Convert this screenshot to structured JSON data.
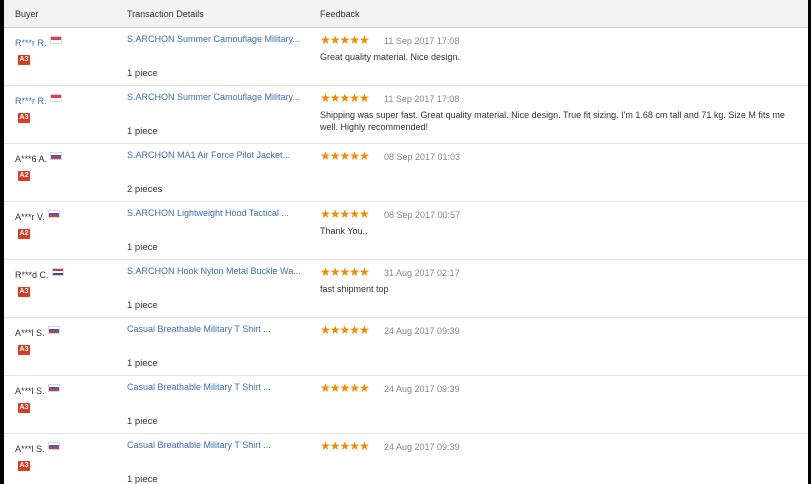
{
  "header": {
    "buyer": "Buyer",
    "transaction": "Transaction Details",
    "feedback": "Feedback"
  },
  "colors": {
    "star": "#f08c00",
    "link": "#3a6fb5",
    "badge": "#d83c22"
  },
  "rows": [
    {
      "buyer": "R***r R.",
      "buyer_link": true,
      "flag": "sg",
      "level": "A3",
      "product": "S.ARCHON Summer Camouflage Military...",
      "quantity": "1 piece",
      "stars": "★★★★★",
      "date": "11 Sep 2017 17:08",
      "feedback": "Great quality material. Nice design."
    },
    {
      "buyer": "R***r R.",
      "buyer_link": true,
      "flag": "sg",
      "level": "A3",
      "product": "S.ARCHON Summer Camouflage Military...",
      "quantity": "1 piece",
      "stars": "★★★★★",
      "date": "11 Sep 2017 17:08",
      "feedback": "Shipping was super fast. Great quality material. Nice design. True fit sizing. I'm 1.68 cm tall and 71 kg. Size M fits me well. Highly recommended!"
    },
    {
      "buyer": "A***6 A.",
      "buyer_link": false,
      "flag": "ru",
      "level": "A2",
      "product": "S.ARCHON MA1 Air Force Pilot Jacket...",
      "quantity": "2 pieces",
      "stars": "★★★★★",
      "date": "08 Sep 2017 01:03",
      "feedback": ""
    },
    {
      "buyer": "A***r V.",
      "buyer_link": false,
      "flag": "ru",
      "level": "A2",
      "product": "S.ARCHON Lightweight Hood Tactical ...",
      "quantity": "1 piece",
      "stars": "★★★★★",
      "date": "08 Sep 2017 00:57",
      "feedback": "Thank You.."
    },
    {
      "buyer": "R***d C.",
      "buyer_link": false,
      "flag": "nl",
      "level": "A3",
      "product": "S.ARCHON Hook Nylon Metal Buckle Wa...",
      "quantity": "1 piece",
      "stars": "★★★★★",
      "date": "31 Aug 2017 02:17",
      "feedback": "fast shipment top"
    },
    {
      "buyer": "A***l S.",
      "buyer_link": false,
      "flag": "ru",
      "level": "A3",
      "product": "Casual Breathable Military T Shirt ...",
      "quantity": "1 piece",
      "stars": "★★★★★",
      "date": "24 Aug 2017 09:39",
      "feedback": ""
    },
    {
      "buyer": "A***l S.",
      "buyer_link": false,
      "flag": "ru",
      "level": "A3",
      "product": "Casual Breathable Military T Shirt ...",
      "quantity": "1 piece",
      "stars": "★★★★★",
      "date": "24 Aug 2017 09:39",
      "feedback": ""
    },
    {
      "buyer": "A***l S.",
      "buyer_link": false,
      "flag": "ru",
      "level": "A3",
      "product": "Casual Breathable Military T Shirt ...",
      "quantity": "1 piece",
      "stars": "★★★★★",
      "date": "24 Aug 2017 09:39",
      "feedback": ""
    }
  ]
}
